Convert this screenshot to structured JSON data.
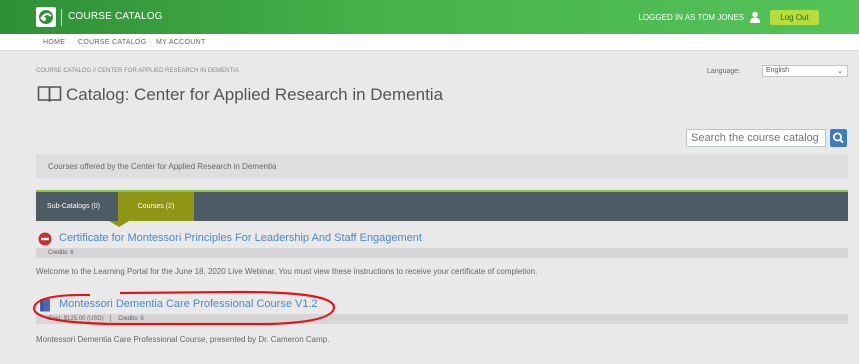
{
  "header": {
    "app_title": "COURSE CATALOG",
    "login_status": "LOGGED IN AS TOM JONES",
    "logout_label": "Log Out",
    "brand_color": "#47b24a",
    "logout_color": "#b6dc3d"
  },
  "nav": {
    "items": [
      {
        "label": "HOME"
      },
      {
        "label": "COURSE CATALOG"
      },
      {
        "label": "MY ACCOUNT"
      }
    ]
  },
  "breadcrumb": "COURSE CATALOG // CENTER FOR APPLIED RESEARCH IN DEMENTIA",
  "language": {
    "label": "Language:",
    "selected": "English"
  },
  "page": {
    "title": "Catalog: Center for Applied Research in Dementia",
    "title_icon": "book-open-icon"
  },
  "search": {
    "placeholder": "Search the course catalog",
    "icon": "search-icon"
  },
  "description": "Courses offered by the Center for Applied Research in Dementia",
  "tabs": [
    {
      "label": "Sub-Catalogs (0)",
      "active": false
    },
    {
      "label": "Courses (2)",
      "active": true
    }
  ],
  "courses": [
    {
      "title": "Certificate for Montessori Principles For Leadership And Staff Engagement",
      "icon": "no-entry-icon",
      "credits_label": "Credits:",
      "credits": "6",
      "description": "Welcome to the Learning Portal for the June 18, 2020 Live Webinar. You must view these instructions to receive your certificate of completion."
    },
    {
      "title": "Montessori Dementia Care Professional Course V1.2",
      "icon": "book-icon",
      "cost_label": "Cost:",
      "cost": "$125.00 (USD)",
      "credits_label": "Credits:",
      "credits": "6",
      "description": "Montessori Dementia Care Professional Course, presented by Dr. Cameron Camp."
    }
  ]
}
